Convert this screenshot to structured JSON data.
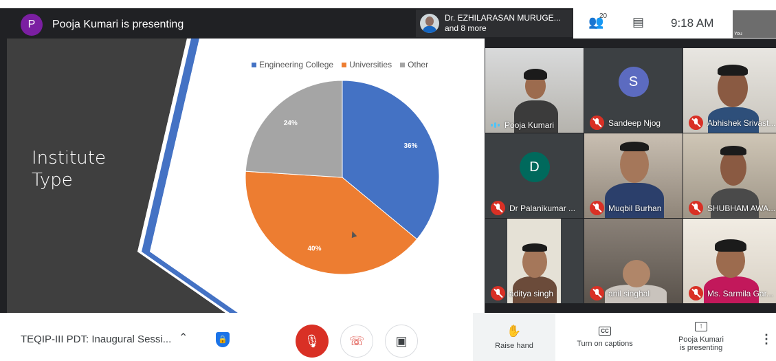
{
  "top_bar": {
    "presenter_initial": "P",
    "presenter_text": "Pooja Kumari is presenting",
    "host_name": "Dr. EZHILARASAN MURUGE...",
    "host_more": "and 8 more",
    "people_count": "20",
    "time": "9:18 AM",
    "self_label": "You"
  },
  "slide": {
    "title_line1": "Institute",
    "title_line2": "Type"
  },
  "chart_data": {
    "type": "pie",
    "series": [
      {
        "name": "Engineering College",
        "value": 36,
        "label": "36%",
        "color": "#4472c4"
      },
      {
        "name": "Universities",
        "value": 40,
        "label": "40%",
        "color": "#ed7d31"
      },
      {
        "name": "Other",
        "value": 24,
        "label": "24%",
        "color": "#a5a5a5"
      }
    ],
    "legend_position": "top"
  },
  "participants": [
    {
      "name": "Pooja Kumari",
      "status": "speaking"
    },
    {
      "name": "Sandeep Njog",
      "status": "muted",
      "initial": "S",
      "avatar_color": "#5c6bc0"
    },
    {
      "name": "Abhishek Srivast...",
      "status": "muted"
    },
    {
      "name": "Dr Palanikumar ...",
      "status": "muted",
      "initial": "D",
      "avatar_color": "#00695c"
    },
    {
      "name": "Muqbil Burhan",
      "status": "muted"
    },
    {
      "name": "SHUBHAM AWA...",
      "status": "muted"
    },
    {
      "name": "aditya singh",
      "status": "muted"
    },
    {
      "name": "anil singhal",
      "status": "muted"
    },
    {
      "name": "Ms. Sarmila Gar...",
      "status": "muted"
    }
  ],
  "bottom_bar": {
    "meeting_title": "TEQIP-III PDT: Inaugural Sessi...",
    "raise_hand": "Raise hand",
    "captions": "Turn on captions",
    "captions_icon": "CC",
    "presenting_line1": "Pooja Kumari",
    "presenting_line2": "is presenting"
  }
}
